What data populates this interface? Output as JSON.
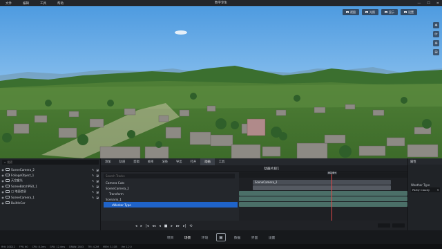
{
  "menu": {
    "items": [
      "文件",
      "编辑",
      "工具",
      "帮助"
    ],
    "title": "数字孪生"
  },
  "window_controls": [
    "—",
    "☐",
    "✕"
  ],
  "viewport_toolbar": [
    "视图",
    "光照",
    "显示",
    "设置"
  ],
  "viewport_side_icons": [
    "move-icon",
    "rotate-icon",
    "zoom-icon",
    "grid-icon"
  ],
  "outliner": {
    "search_placeholder": "搜索",
    "rows": [
      {
        "label": "SceneCamera_2",
        "level": 0
      },
      {
        "label": "FoliageObject_1",
        "level": 0
      },
      {
        "label": "天空盒光",
        "level": 0
      },
      {
        "label": "SceneBatchPSO_1",
        "level": 0
      },
      {
        "label": "□ 地面信息",
        "level": 0
      },
      {
        "label": "SceneCamera_1",
        "level": 0
      },
      {
        "label": "BuiltInCar",
        "level": 0
      }
    ]
  },
  "sequencer": {
    "tabs": [
      "添加",
      "轨道",
      "剪辑",
      "帧率",
      "渲染",
      "导出",
      "打开",
      "动画",
      "工具"
    ],
    "active_tab": "动画",
    "title": "动画片段1",
    "track_search_placeholder": "Search Tracks",
    "tracks": [
      "Camera Cuts",
      "SceneCamera_2",
      "Transform",
      "Scenario_1",
      "sWorker Type"
    ],
    "selected_track": "sWorker Type",
    "playhead_label": "0028+",
    "timeline_bars": [
      {
        "label": "SceneCamera_2",
        "row": 0,
        "color": "#4a4f57"
      },
      {
        "label": "",
        "row": 1,
        "color": "#555a62"
      },
      {
        "label": "",
        "row": 2,
        "color": "#4b6f68"
      },
      {
        "label": "",
        "row": 3,
        "color": "#4b6f68"
      },
      {
        "label": "",
        "row": 4,
        "color": "#4b6f68"
      }
    ],
    "transport": [
      "◂",
      "▸",
      "|◂",
      "◂◂",
      "◂",
      "■",
      "▸",
      "▸▸",
      "▸|",
      "⟲"
    ]
  },
  "details": {
    "header": "属性",
    "field_label": "Weather Type",
    "field_value": "Partly Cloudy"
  },
  "bottom_nav": {
    "items": [
      "项目",
      "场景",
      "环境",
      "▣",
      "数据",
      "界面",
      "设置"
    ],
    "active": "场景"
  },
  "status": {
    "items": [
      "RHI: D3D12",
      "FPS: 60",
      "CPU: 8.2ms",
      "GPU: 12.4ms",
      "DRAW: 2843",
      "TRI: 4.2M",
      "MEM: 3.1GB",
      "Ver 1.2.0"
    ]
  }
}
